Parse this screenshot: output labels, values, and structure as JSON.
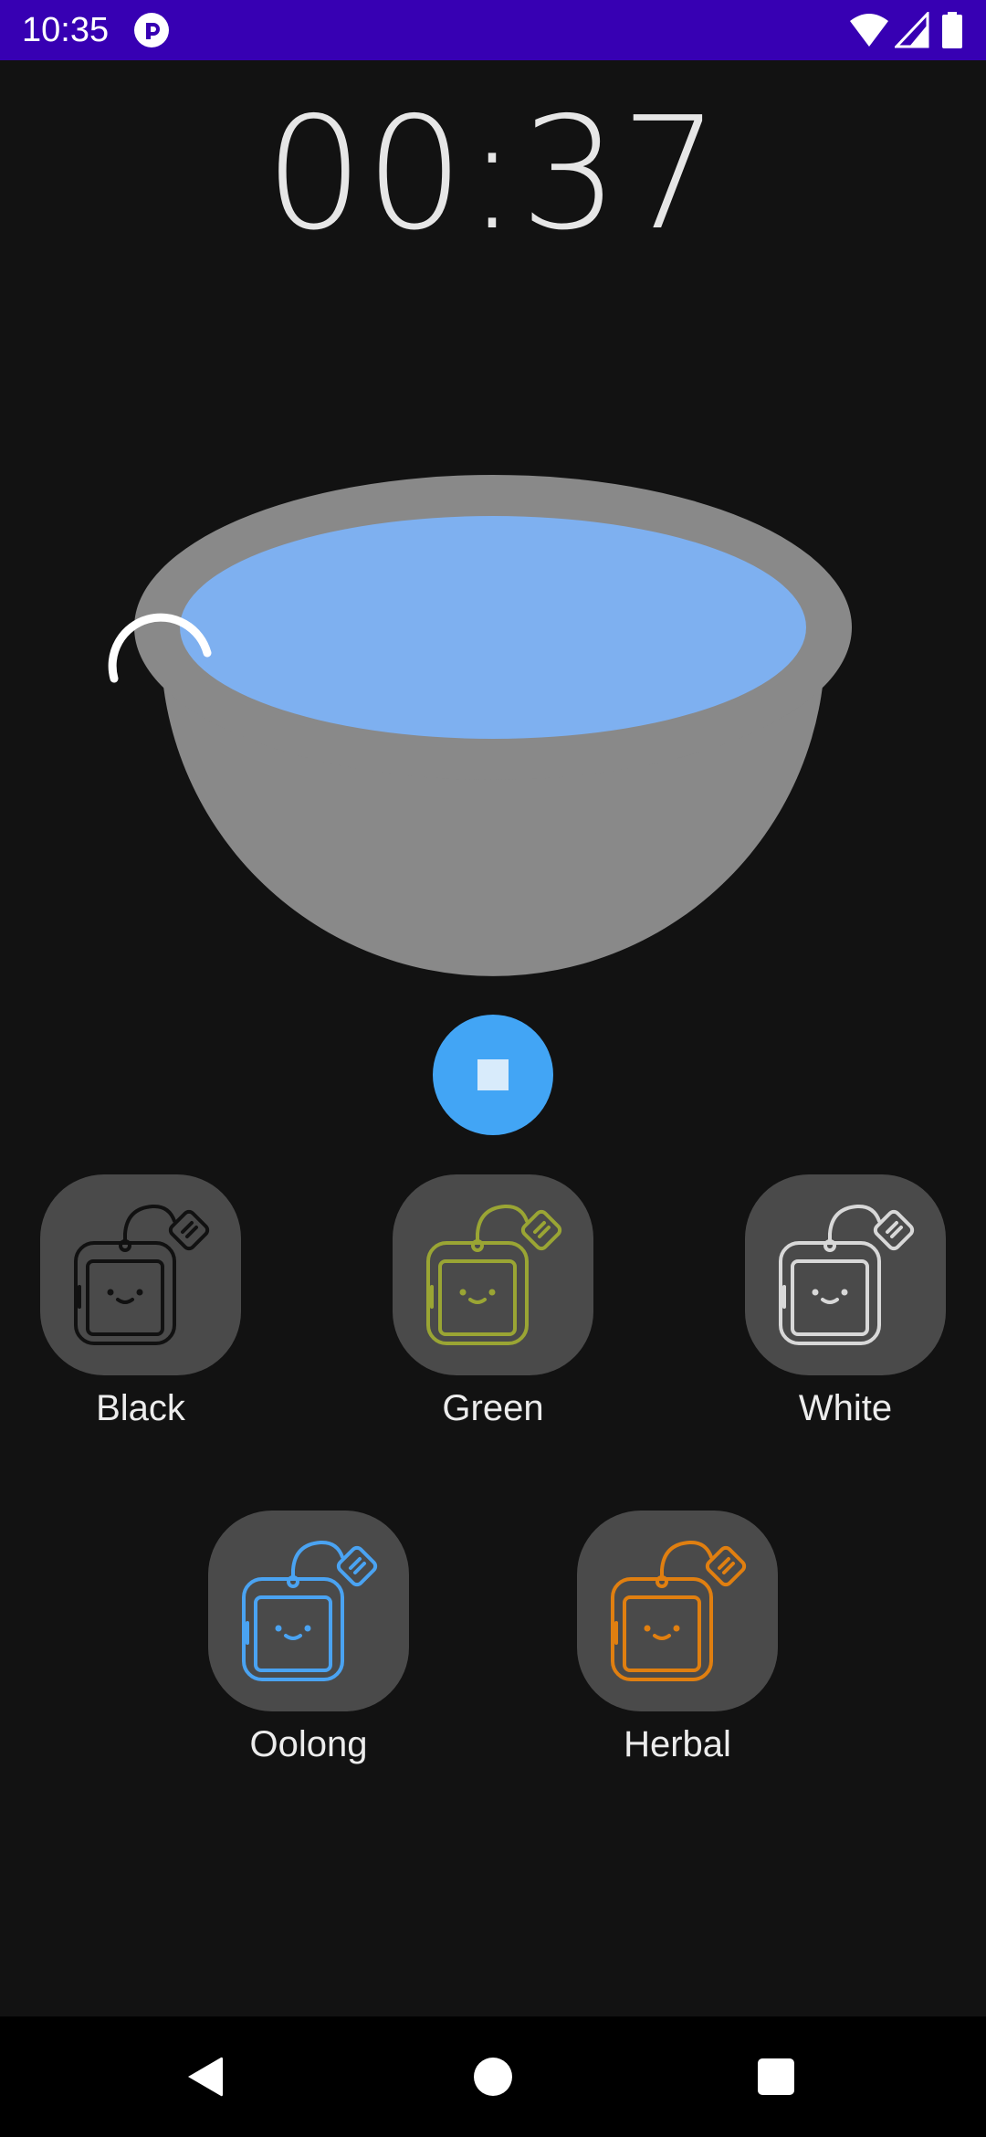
{
  "status_bar": {
    "time": "10:35",
    "app_icon": "pocket-casts-style-icon",
    "wifi_icon": "wifi-icon",
    "signal_icon": "cell-signal-icon",
    "battery_icon": "battery-icon",
    "background_color": "#3700b3"
  },
  "timer": {
    "display": "00:37"
  },
  "bowl": {
    "icon": "tea-bowl-illustration",
    "bowl_color": "#898989",
    "liquid_color": "#7eb0f0"
  },
  "controls": {
    "stop_icon": "stop-icon",
    "button_color": "#42a5f5"
  },
  "teas": [
    {
      "label": "Black",
      "color": "#111111"
    },
    {
      "label": "Green",
      "color": "#9aa534"
    },
    {
      "label": "White",
      "color": "#d8d8d8"
    },
    {
      "label": "Oolong",
      "color": "#4aa3f2"
    },
    {
      "label": "Herbal",
      "color": "#e07f10"
    }
  ],
  "nav_bar": {
    "back_icon": "back-triangle-icon",
    "home_icon": "home-circle-icon",
    "recents_icon": "recents-square-icon"
  }
}
